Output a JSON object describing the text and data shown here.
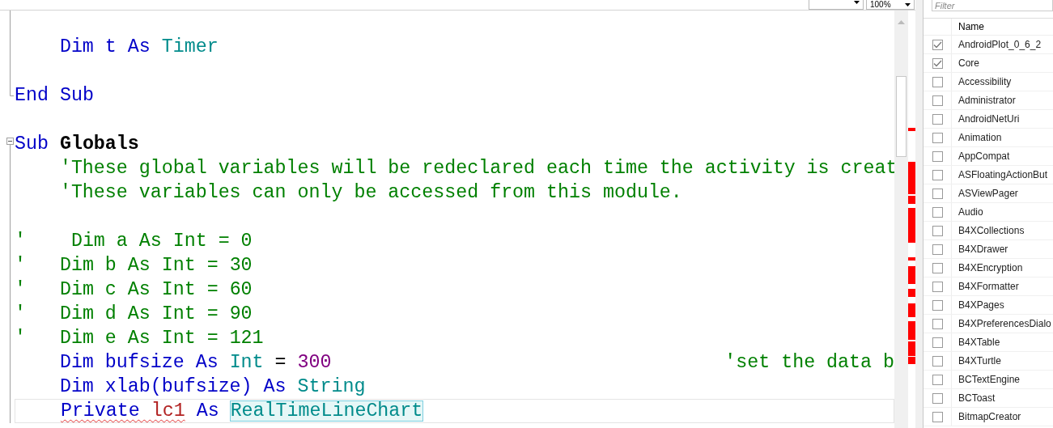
{
  "toolbar": {
    "zoom": "100%"
  },
  "editor": {
    "lines": [
      {
        "kind": "fold-line",
        "current": false
      },
      {
        "kind": "fold-line",
        "current": false,
        "indented": true,
        "tokens": [
          {
            "text": "Dim t As ",
            "kind": "keyword"
          },
          {
            "text": "Timer",
            "kind": "type"
          }
        ]
      },
      {
        "kind": "fold-line",
        "current": false
      },
      {
        "kind": "fold-end",
        "current": false,
        "tokens": [
          {
            "text": "End Sub",
            "kind": "keyword"
          }
        ]
      },
      {
        "kind": "plain",
        "current": false
      },
      {
        "kind": "fold-start",
        "current": false,
        "tokens": [
          {
            "text": "Sub ",
            "kind": "keyword"
          },
          {
            "text": "Globals",
            "kind": "name"
          }
        ]
      },
      {
        "kind": "fold-line",
        "current": false,
        "indented": true,
        "tokens": [
          {
            "text": "'These global variables will be redeclared each time the activity is creat",
            "kind": "comment"
          }
        ]
      },
      {
        "kind": "fold-line",
        "current": false,
        "indented": true,
        "tokens": [
          {
            "text": "'These variables can only be accessed from this module.",
            "kind": "comment"
          }
        ]
      },
      {
        "kind": "fold-line",
        "current": false
      },
      {
        "kind": "fold-line",
        "current": false,
        "tokens": [
          {
            "text": "'    Dim a As Int = 0",
            "kind": "comment"
          }
        ]
      },
      {
        "kind": "fold-line",
        "current": false,
        "tokens": [
          {
            "text": "'   Dim b As Int = 30",
            "kind": "comment"
          }
        ]
      },
      {
        "kind": "fold-line",
        "current": false,
        "tokens": [
          {
            "text": "'   Dim c As Int = 60",
            "kind": "comment"
          }
        ]
      },
      {
        "kind": "fold-line",
        "current": false,
        "tokens": [
          {
            "text": "'   Dim d As Int = 90",
            "kind": "comment"
          }
        ]
      },
      {
        "kind": "fold-line",
        "current": false,
        "tokens": [
          {
            "text": "'   Dim e As Int = 121",
            "kind": "comment"
          }
        ]
      },
      {
        "kind": "fold-line",
        "current": false,
        "indented": true,
        "tokens": [
          {
            "text": "Dim bufsize As ",
            "kind": "keyword"
          },
          {
            "text": "Int",
            "kind": "type"
          },
          {
            "text": " = ",
            "kind": "plain"
          },
          {
            "text": "300",
            "kind": "number"
          }
        ],
        "trailing_comment": "'set the data b"
      },
      {
        "kind": "fold-line",
        "current": false,
        "indented": true,
        "tokens": [
          {
            "text": "Dim xlab(bufsize) As ",
            "kind": "keyword"
          },
          {
            "text": "String",
            "kind": "type"
          }
        ]
      },
      {
        "kind": "fold-line",
        "current": true,
        "indented": true,
        "tokens": [
          {
            "text": "Private ",
            "kind": "keyword-error"
          },
          {
            "text": "lc1",
            "kind": "error"
          },
          {
            "text": " As ",
            "kind": "keyword"
          },
          {
            "text": "RealTimeLineChart",
            "kind": "highlight"
          }
        ]
      }
    ]
  },
  "panel": {
    "filter": {
      "placeholder": "Filter"
    },
    "column": "Name",
    "libraries": [
      {
        "name": "AndroidPlot_0_6_2",
        "checked": true
      },
      {
        "name": "Core",
        "checked": true
      },
      {
        "name": "Accessibility",
        "checked": false
      },
      {
        "name": "Administrator",
        "checked": false
      },
      {
        "name": "AndroidNetUri",
        "checked": false
      },
      {
        "name": "Animation",
        "checked": false
      },
      {
        "name": "AppCompat",
        "checked": false
      },
      {
        "name": "ASFloatingActionBut",
        "checked": false
      },
      {
        "name": "ASViewPager",
        "checked": false
      },
      {
        "name": "Audio",
        "checked": false
      },
      {
        "name": "B4XCollections",
        "checked": false
      },
      {
        "name": "B4XDrawer",
        "checked": false
      },
      {
        "name": "B4XEncryption",
        "checked": false
      },
      {
        "name": "B4XFormatter",
        "checked": false
      },
      {
        "name": "B4XPages",
        "checked": false
      },
      {
        "name": "B4XPreferencesDialo",
        "checked": false
      },
      {
        "name": "B4XTable",
        "checked": false
      },
      {
        "name": "B4XTurtle",
        "checked": false
      },
      {
        "name": "BCTextEngine",
        "checked": false
      },
      {
        "name": "BCToast",
        "checked": false
      },
      {
        "name": "BitmapCreator",
        "checked": false
      }
    ]
  }
}
